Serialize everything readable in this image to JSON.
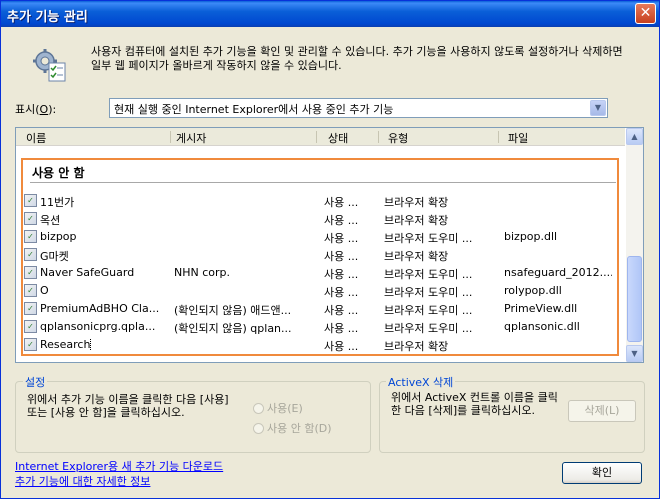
{
  "window": {
    "title": "추가 기능 관리",
    "close_glyph": "✕"
  },
  "description": "사용자 컴퓨터에 설치된 추가 기능을 확인 및 관리할 수 있습니다. 추가 기능을 사용하지 않도록 설정하거나 삭제하면 일부 웹 페이지가 올바르게 작동하지 않을 수 있습니다.",
  "show": {
    "label": "표시(",
    "accel": "O",
    "label_end": "):",
    "selected": "현재 실행 중인 Internet Explorer에서 사용 중인 추가 기능"
  },
  "list": {
    "columns": [
      "이름",
      "게시자",
      "상태",
      "유형",
      "파일"
    ],
    "group_title": "사용 안 함",
    "rows": [
      {
        "name": "11번가",
        "publisher": "",
        "status": "사용 ...",
        "type": "브라우저 확장",
        "file": ""
      },
      {
        "name": "옥션",
        "publisher": "",
        "status": "사용 ...",
        "type": "브라우저 확장",
        "file": ""
      },
      {
        "name": "bizpop",
        "publisher": "",
        "status": "사용 ...",
        "type": "브라우저 도우미 ...",
        "file": "bizpop.dll"
      },
      {
        "name": "G마켓",
        "publisher": "",
        "status": "사용 ...",
        "type": "브라우저 확장",
        "file": ""
      },
      {
        "name": "Naver SafeGuard",
        "publisher": "NHN corp.",
        "status": "사용 ...",
        "type": "브라우저 도우미 ...",
        "file": "nsafeguard_2012...."
      },
      {
        "name": "O",
        "publisher": "",
        "status": "사용 ...",
        "type": "브라우저 도우미 ...",
        "file": "rolypop.dll"
      },
      {
        "name": "PremiumAdBHO Cla...",
        "publisher": "(확인되지 않음) 애드앤...",
        "status": "사용 ...",
        "type": "브라우저 도우미 ...",
        "file": "PrimeView.dll"
      },
      {
        "name": "qplansonicprg.qpla...",
        "publisher": "(확인되지 않음) qplan...",
        "status": "사용 ...",
        "type": "브라우저 도우미 ...",
        "file": "qplansonic.dll"
      },
      {
        "name": "Research",
        "publisher": "",
        "status": "사용 ...",
        "type": "브라우저 확장",
        "file": ""
      }
    ]
  },
  "settings": {
    "title": "설정",
    "text": "위에서 추가 기능 이름을 클릭한 다음 [사용] 또는 [사용 안 함]을 클릭하십시오.",
    "enable_label": "사용(E)",
    "disable_label": "사용 안 함(D)"
  },
  "activex": {
    "title": "ActiveX 삭제",
    "text": "위에서 ActiveX 컨트롤 이름을 클릭한 다음 [삭제]를 클릭하십시오.",
    "delete_label": "삭제(L)"
  },
  "links": {
    "download": "Internet Explorer용 새 추가 기능 다운로드",
    "more_info": "추가 기능에 대한 자세한 정보"
  },
  "ok_label": "확인"
}
